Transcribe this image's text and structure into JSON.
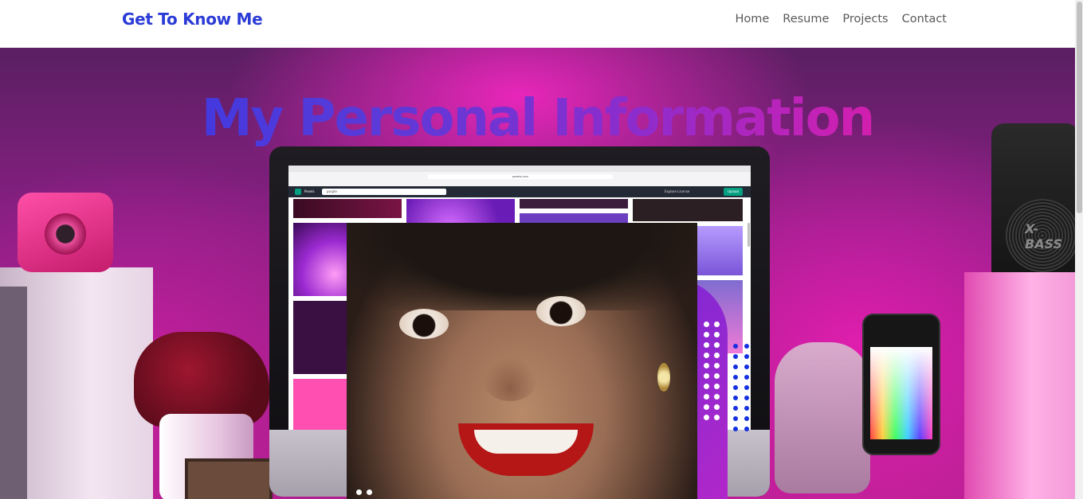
{
  "navbar": {
    "brand": "Get To Know Me",
    "links": [
      "Home",
      "Resume",
      "Projects",
      "Contact"
    ]
  },
  "hero": {
    "title": "My Personal Information",
    "background_decor": {
      "speaker_label": "X-BASS"
    }
  },
  "monitor_screen": {
    "search_value": "purple",
    "site_name": "Pexels",
    "menu": "Explore   License",
    "join_label": "Upload",
    "url": "pexels.com"
  },
  "colors": {
    "brand": "#2b3bd6",
    "nav_text": "#5a5a5a",
    "title_gradient_start": "#2a38e6",
    "title_gradient_end": "#e01a94"
  }
}
